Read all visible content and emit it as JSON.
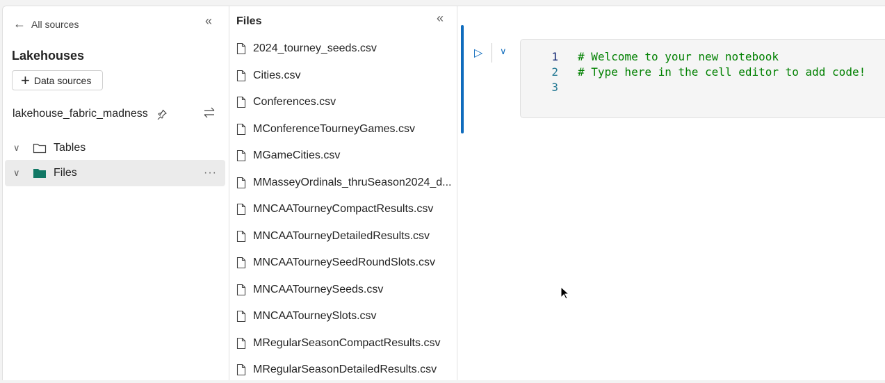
{
  "left_panel": {
    "back_label": "All sources",
    "title": "Lakehouses",
    "data_sources_label": "Data sources",
    "lakehouse_name": "lakehouse_fabric_madness",
    "tree": [
      {
        "label": "Tables"
      },
      {
        "label": "Files"
      }
    ]
  },
  "files_panel": {
    "title": "Files",
    "items": [
      "2024_tourney_seeds.csv",
      "Cities.csv",
      "Conferences.csv",
      "MConferenceTourneyGames.csv",
      "MGameCities.csv",
      "MMasseyOrdinals_thruSeason2024_d...",
      "MNCAATourneyCompactResults.csv",
      "MNCAATourneyDetailedResults.csv",
      "MNCAATourneySeedRoundSlots.csv",
      "MNCAATourneySeeds.csv",
      "MNCAATourneySlots.csv",
      "MRegularSeasonCompactResults.csv",
      "MRegularSeasonDetailedResults.csv"
    ]
  },
  "editor": {
    "lines": [
      {
        "n": "1",
        "code": "# Welcome to your new notebook"
      },
      {
        "n": "2",
        "code": "# Type here in the cell editor to add code!"
      },
      {
        "n": "3",
        "code": ""
      }
    ]
  },
  "colors": {
    "accent": "#0f6cbd",
    "files_folder": "#117865",
    "comment": "#008000"
  }
}
